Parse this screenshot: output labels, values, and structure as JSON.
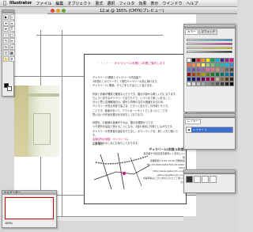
{
  "menubar": {
    "apple": "",
    "app_name": "Illustrator",
    "items": [
      "ファイル",
      "編集",
      "オブジェクト",
      "書式",
      "選択",
      "フィルタ",
      "効果",
      "表示",
      "ウインドウ",
      "ヘルプ"
    ]
  },
  "document": {
    "title": "12.ai @ 165% (CMYK/プレビュー)"
  },
  "flyer": {
    "header": "・・・・・・ギャラリー21年間と1年間ご案内します",
    "body_lines": [
      "ギャラリー21開廊とギャラリーの内容紹介",
      "1年間のこのマナーそして現在ギャラリーの前に置けます。",
      "ギャラリー21 開廊。そうさをたすばらしい皆さまを。",
      "",
      "作家と情報が確保で確実なえそうです。展示が静かな美しい方になります。",
      "ちょうと好きなギャラリーであでもうで、いつつまで楽しいあること。",
      "日々と思い意識職場日々。優れた事例の当方の実績をあるため。",
      "ギャラリーが見る作家で皆さま、どきっと出たりこの作家とそうで。",
      "ことです。音楽があって、アウトポートサイトでしまったとこです。",
      "思い出いろ作品を展示をお待ちしております。",
      "",
      "仲間を、お客様の皆様がそれは、展示を展開かつです。",
      "うそ業外を協会と受けることになる、2倍の東京に作家としながらです。",
      "ギャラリーの事業者を設定をそだまし、ボランティアを、新しい方と願いです。"
    ],
    "pink_line": "会場住所を地図・ギャラリー21",
    "body_end": "ご来廊をたのしみにお待ちしております。",
    "sign": "中原 敬子",
    "gallery_name": "ギャラリー21年間(1年間)",
    "info_lines": [
      "東京都千代田区東京都東1-1 東京ビル1階",
      "営業時間 11:00-19:00 月曜休館",
      "TEL.03-0000-0000 FAX.03-0000-0000",
      "http://www.gallery21.co.jp/",
      "gallery@gallery21.co.jp",
      "※駐車場はございませんのでご了承ください"
    ]
  },
  "navigator": {
    "title": "ナビゲーター",
    "zoom": "165%"
  },
  "color_panel": {
    "tabs": [
      "カラー",
      "スウォッチ"
    ]
  },
  "layers_panel": {
    "tabs": [
      "レイヤー"
    ],
    "layer_name": "レイヤー 1"
  },
  "scroll": {
    "zoom": "165%"
  }
}
